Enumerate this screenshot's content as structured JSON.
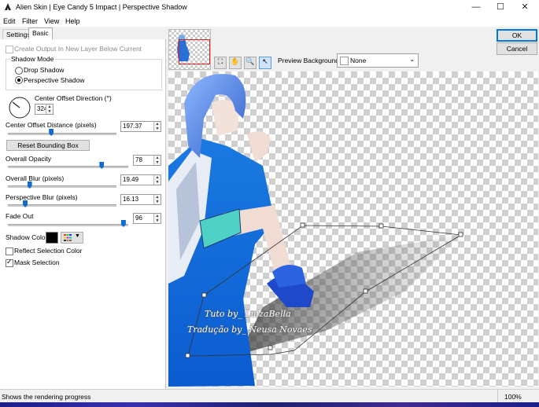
{
  "window": {
    "title": "Alien Skin | Eye Candy 5 Impact | Perspective Shadow",
    "buttons": [
      "—",
      "☐",
      "✕"
    ]
  },
  "menu": [
    "Edit",
    "Filter",
    "View",
    "Help"
  ],
  "tabs": [
    "Settings",
    "Basic"
  ],
  "basic": {
    "create_output_label": "Create Output In New Layer Below Current",
    "shadow_mode_label": "Shadow Mode",
    "drop_shadow_label": "Drop Shadow",
    "perspective_shadow_label": "Perspective Shadow",
    "selected_mode": "Perspective Shadow",
    "direction_label": "Center Offset Direction (°)",
    "direction_value": "324",
    "distance_label": "Center Offset Distance (pixels)",
    "distance_value": "197.37",
    "distance_fraction": 0.4,
    "reset_button": "Reset Bounding Box",
    "opacity_label": "Overall Opacity",
    "opacity_value": "78",
    "opacity_fraction": 0.78,
    "blur_label": "Overall Blur (pixels)",
    "blur_value": "19.49",
    "blur_fraction": 0.2,
    "pblur_label": "Perspective Blur (pixels)",
    "pblur_value": "16.13",
    "pblur_fraction": 0.16,
    "fade_label": "Fade Out",
    "fade_value": "96",
    "fade_fraction": 0.96,
    "shadow_color_label": "Shadow Color",
    "shadow_color": "#000000",
    "reflect_label": "Reflect Selection Color",
    "reflect_checked": false,
    "mask_label": "Mask Selection",
    "mask_checked": true
  },
  "actions": {
    "ok": "OK",
    "cancel": "Cancel"
  },
  "toolbar": {
    "tools": [
      "zoom-fit-icon",
      "hand-icon",
      "zoom-icon",
      "pointer-icon"
    ],
    "preview_bg_label": "Preview Background:",
    "preview_bg_value": "None"
  },
  "watermark": {
    "line1": "Tuto by_ LuizaBella",
    "line2": "Tradução by_ Neusa Novaes"
  },
  "status": {
    "text": "Shows the rendering progress",
    "zoom": "100%"
  },
  "colors": {
    "accent": "#0078d7",
    "slider": "#0d6bd1",
    "selection": "#e11d1d"
  }
}
